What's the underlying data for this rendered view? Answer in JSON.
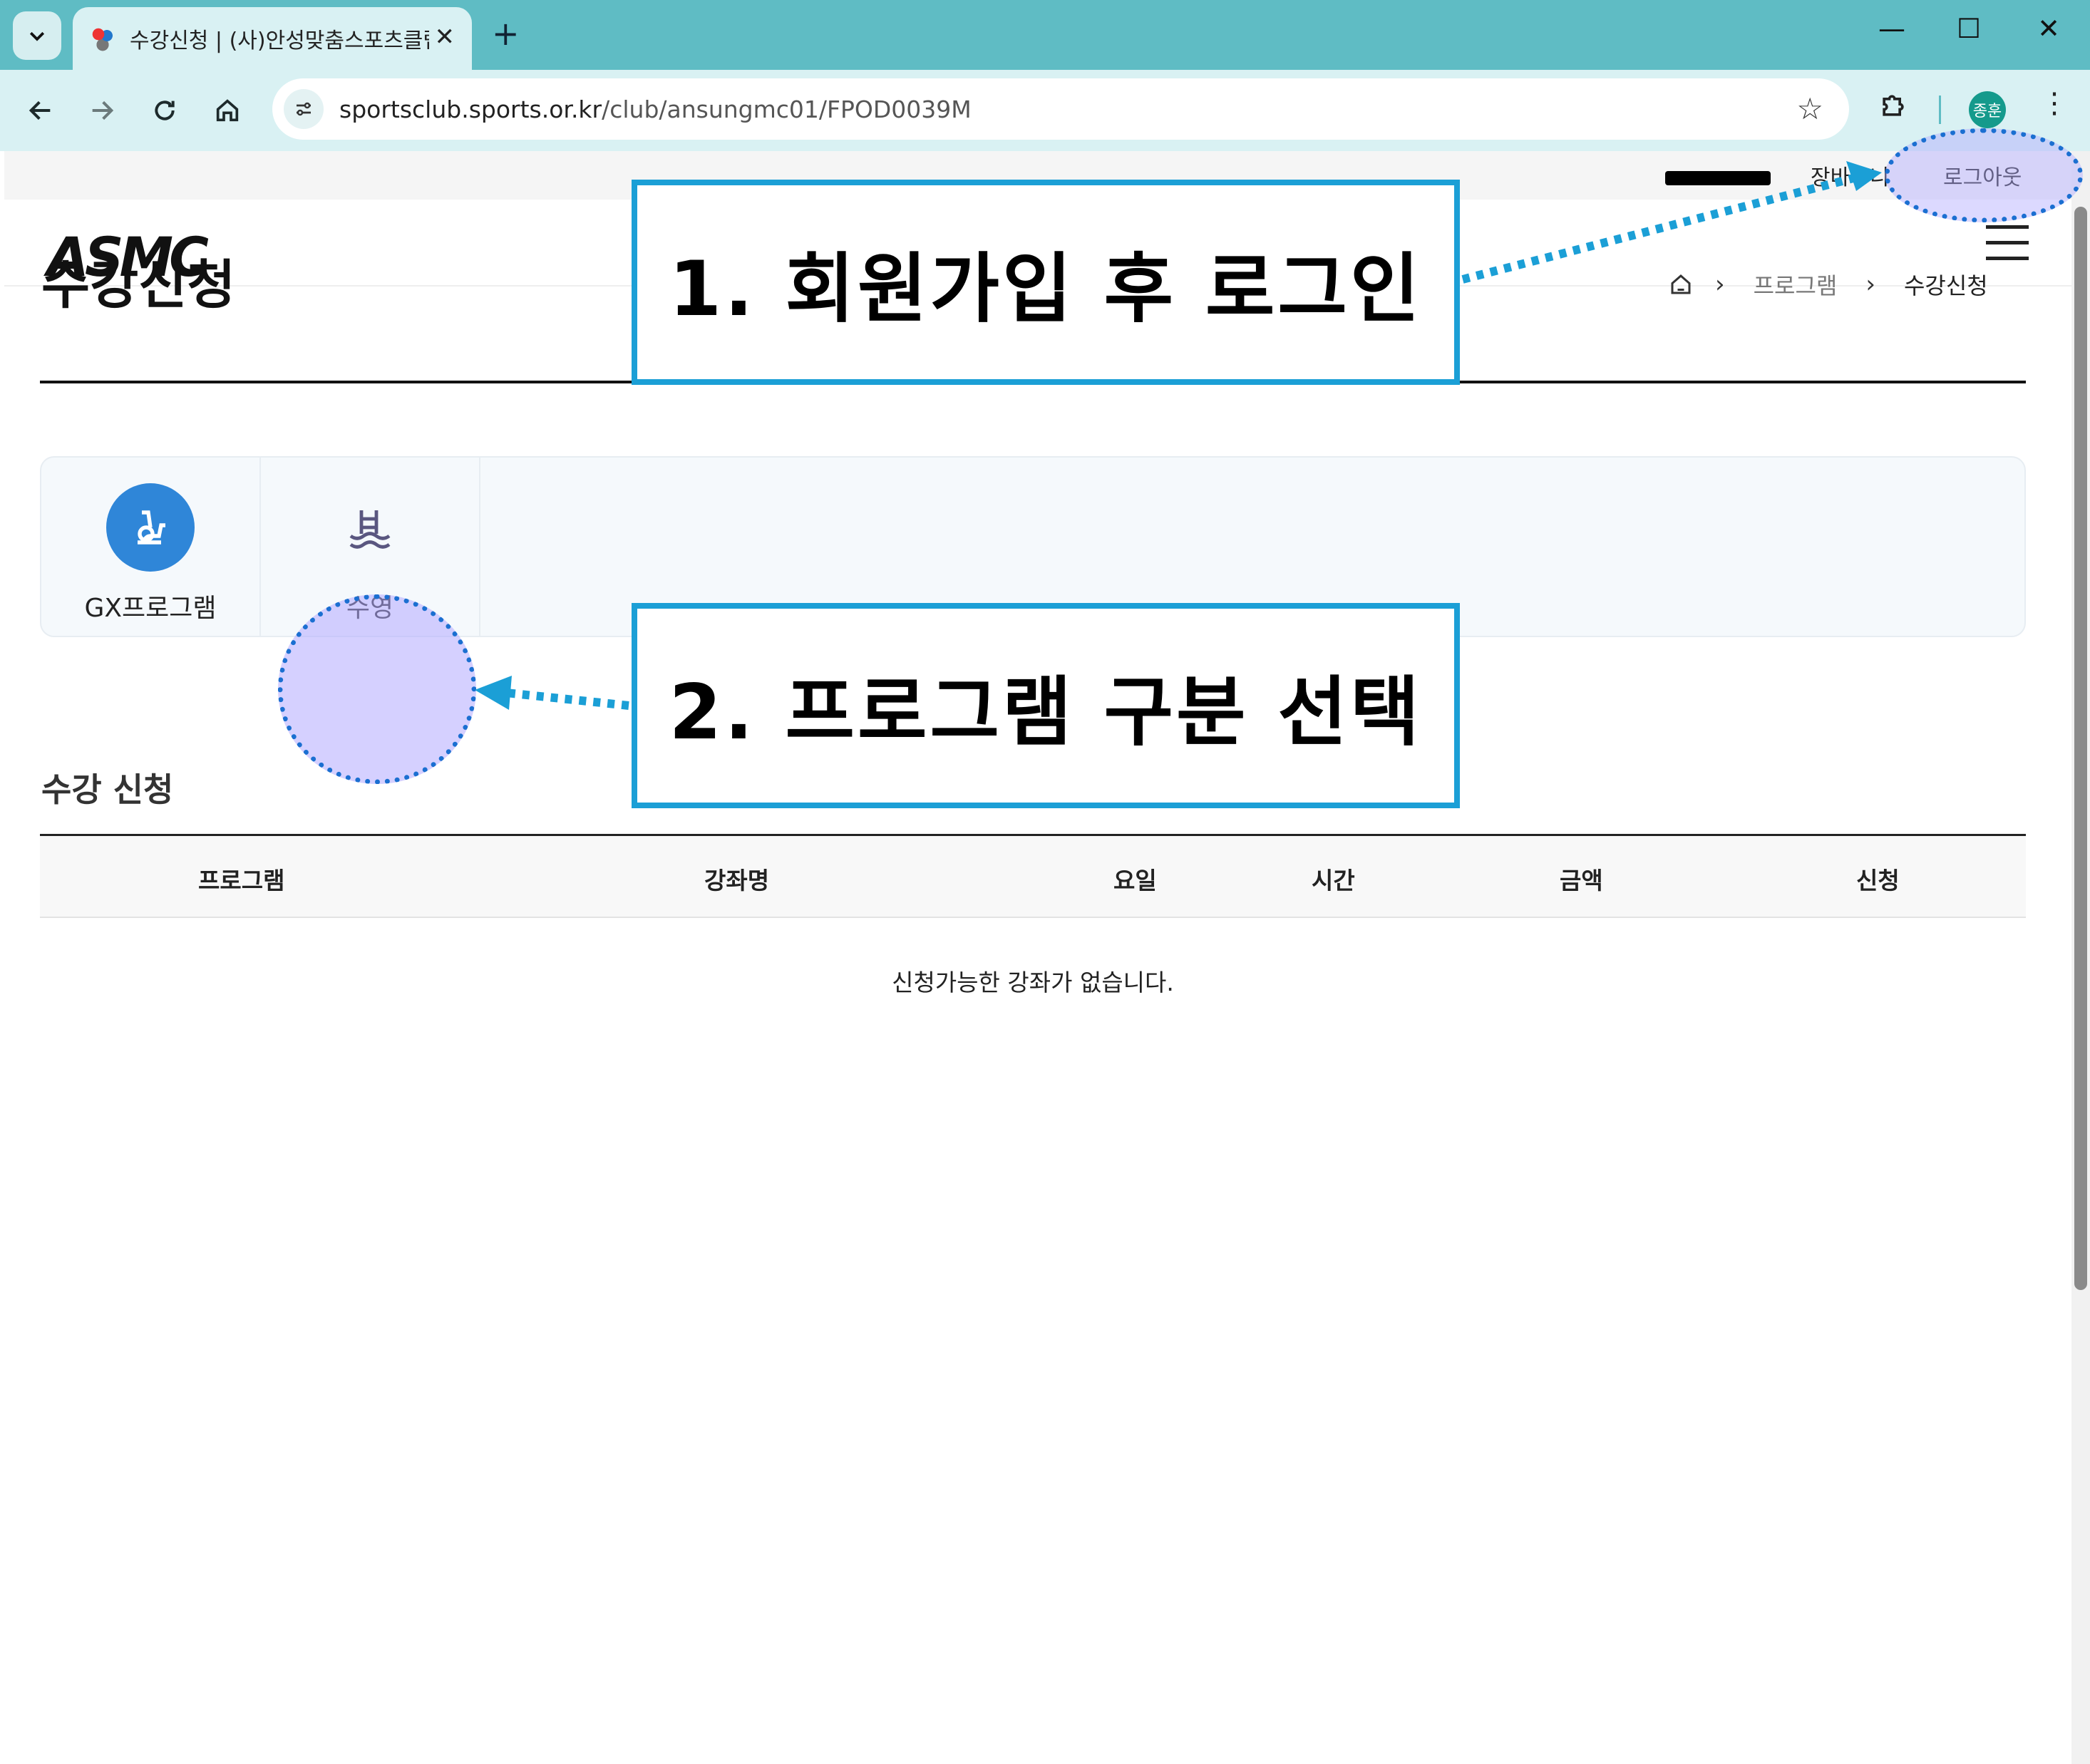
{
  "browser": {
    "tab_title": "수강신청 | (사)안성맞춤스포츠클럽",
    "url_domain": "sportsclub.sports.or.kr",
    "url_path": "/club/ansungmc01/FPOD0039M",
    "profile_initials": "종훈",
    "new_tab_glyph": "+",
    "close_glyph": "✕",
    "minimize_glyph": "—",
    "maximize_glyph": "☐",
    "window_close_glyph": "✕",
    "star_glyph": "☆",
    "kebab_glyph": "⋮"
  },
  "util_nav": {
    "cart": "장바구니",
    "logout": "로그아웃"
  },
  "site": {
    "logo": "ASMC"
  },
  "page": {
    "title": "수강신청",
    "breadcrumb": [
      "프로그램",
      "수강신청"
    ],
    "chevron": "›"
  },
  "categories": [
    {
      "label": "GX프로그램",
      "icon": "exercise-bike-icon",
      "color": "#2f86d8"
    },
    {
      "label": "수영",
      "icon": "swimming-pool-icon",
      "color": "#c8c4ff"
    }
  ],
  "enrollment": {
    "section_title": "수강 신청",
    "columns": [
      "프로그램",
      "강좌명",
      "요일",
      "시간",
      "금액",
      "신청"
    ],
    "empty_message": "신청가능한 강좌가 없습니다."
  },
  "annotations": {
    "step1": "1. 회원가입 후 로그인",
    "step2": "2. 프로그램 구분 선택",
    "accent_color": "#1b9fd6"
  }
}
